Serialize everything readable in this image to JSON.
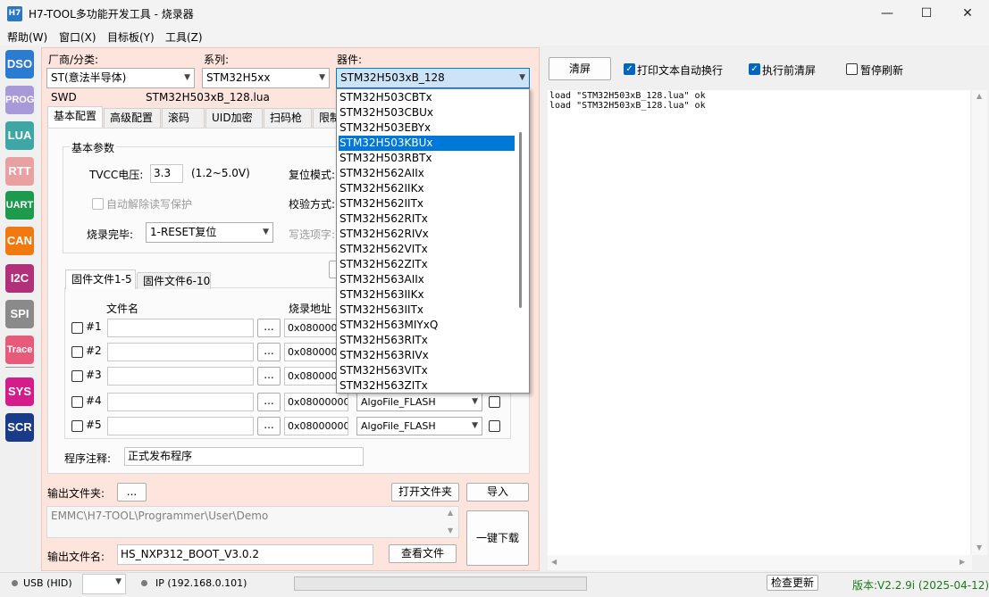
{
  "window": {
    "icon_text": "H7",
    "title": "H7-TOOL多功能开发工具 - 烧录器",
    "minimize": "—",
    "maximize": "☐",
    "close": "✕"
  },
  "menu": [
    "帮助(W)",
    "窗口(X)",
    "目标板(Y)",
    "工具(Z)"
  ],
  "sidebar": [
    {
      "label": "DSO",
      "color": "#2b7bd0"
    },
    {
      "label": "PROG",
      "color": "#a89ad8"
    },
    {
      "label": "LUA",
      "color": "#3fa6a6"
    },
    {
      "label": "RTT",
      "color": "#e8a0a0"
    },
    {
      "label": "UART",
      "color": "#1e9a4e"
    },
    {
      "label": "CAN",
      "color": "#f07a10"
    },
    {
      "label": "I2C",
      "color": "#b0307a"
    },
    {
      "label": "SPI",
      "color": "#8a8a8a"
    },
    {
      "label": "Trace",
      "color": "#e85a7a"
    },
    {
      "label": "SYS",
      "color": "#d41c8a"
    },
    {
      "label": "SCR",
      "color": "#1a3a8a"
    }
  ],
  "selector": {
    "vendor_label": "厂商/分类:",
    "vendor_value": "ST(意法半导体)",
    "series_label": "系列:",
    "series_value": "STM32H5xx",
    "device_label": "器件:",
    "device_value": "STM32H503xB_128",
    "interface": "SWD",
    "lua_file": "STM32H503xB_128.lua"
  },
  "tabs": [
    "基本配置",
    "高级配置",
    "滚码",
    "UID加密",
    "扫码枪",
    "限制"
  ],
  "basic": {
    "group_title": "基本参数",
    "vcc_label": "TVCC电压:",
    "vcc_value": "3.3",
    "vcc_range": "(1.2~5.0V)",
    "reset_mode_label": "复位模式:",
    "auto_unlock_label": "自动解除读写保护",
    "verify_label": "校验方式:",
    "after_burn_label": "烧录完毕:",
    "after_burn_value": "1-RESET复位",
    "write_option_label": "写选项字:"
  },
  "fw_tabs": [
    "固件文件1-5",
    "固件文件6-10"
  ],
  "fw_headers": {
    "filename": "文件名",
    "address": "烧录地址"
  },
  "fw_rows": [
    {
      "id": "#1",
      "browse": "...",
      "addr": "0x08000000",
      "algo": ""
    },
    {
      "id": "#2",
      "browse": "...",
      "addr": "0x08000000",
      "algo": ""
    },
    {
      "id": "#3",
      "browse": "...",
      "addr": "0x08000000",
      "algo": ""
    },
    {
      "id": "#4",
      "browse": "...",
      "addr": "0x08000000",
      "algo": "AlgoFile_FLASH"
    },
    {
      "id": "#5",
      "browse": "...",
      "addr": "0x08000000",
      "algo": "AlgoFile_FLASH"
    }
  ],
  "program_note_label": "程序注释:",
  "program_note_value": "正式发布程序",
  "output": {
    "folder_label": "输出文件夹:",
    "browse": "...",
    "open_folder": "打开文件夹",
    "import": "导入",
    "path": "EMMC\\H7-TOOL\\Programmer\\User\\Demo",
    "one_click": "一键下载",
    "filename_label": "输出文件名:",
    "filename_value": "HS_NXP312_BOOT_V3.0.2",
    "view_file": "查看文件"
  },
  "device_list": [
    "STM32H503CBTx",
    "STM32H503CBUx",
    "STM32H503EBYx",
    "STM32H503KBUx",
    "STM32H503RBTx",
    "STM32H562AIIx",
    "STM32H562IIKx",
    "STM32H562IITx",
    "STM32H562RITx",
    "STM32H562RIVx",
    "STM32H562VITx",
    "STM32H562ZITx",
    "STM32H563AIIx",
    "STM32H563IIKx",
    "STM32H563IITx",
    "STM32H563MIYxQ",
    "STM32H563RITx",
    "STM32H563RIVx",
    "STM32H563VITx",
    "STM32H563ZITx"
  ],
  "device_list_highlight": "STM32H503KBUx",
  "log": {
    "clear": "清屏",
    "wrap_label": "打印文本自动换行",
    "wrap_checked": true,
    "clear_before_label": "执行前清屏",
    "clear_before_checked": true,
    "pause_label": "暂停刷新",
    "pause_checked": false,
    "text": "load \"STM32H503xB_128.lua\" ok\nload \"STM32H503xB_128.lua\" ok"
  },
  "status": {
    "usb": "USB (HID)",
    "ip": "IP (192.168.0.101)",
    "check_update": "检查更新",
    "version": "版本:V2.2.9i (2025-04-12)",
    "version_color": "#1a7a1a"
  }
}
